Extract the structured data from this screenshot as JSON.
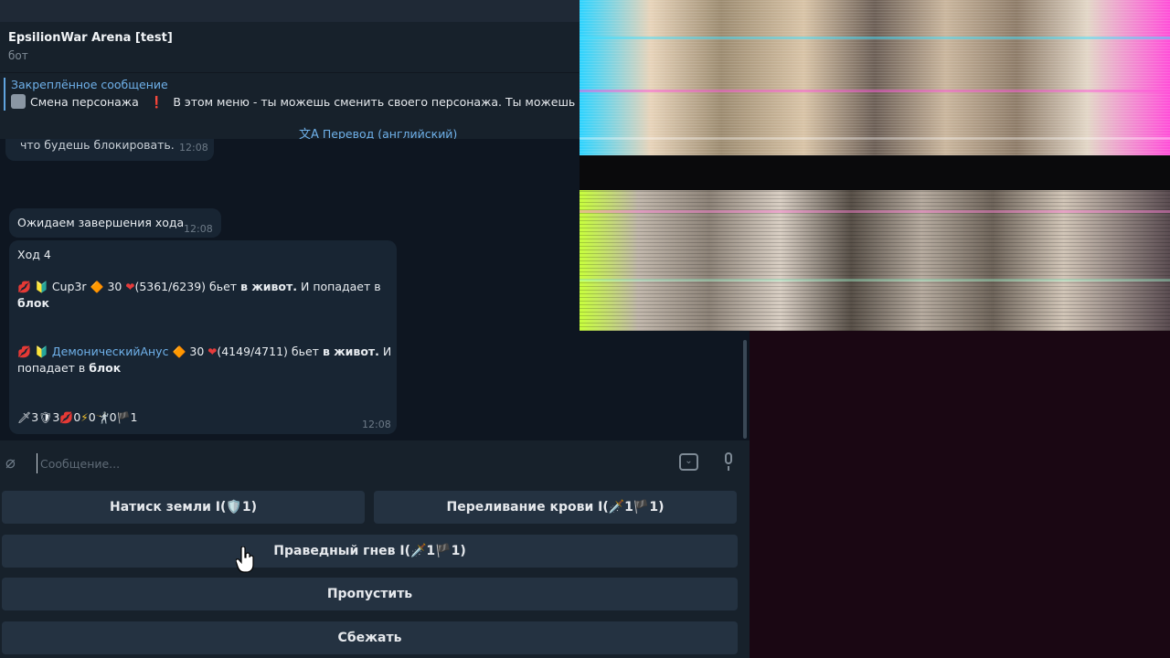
{
  "header": {
    "title": "EpsilionWar Arena [test]",
    "subtitle": "бот"
  },
  "pinned": {
    "title": "Закреплённое сообщение",
    "lead": "Смена персонажа",
    "text": "В этом меню - ты можешь сменить своего персонажа. Ты можешь иметь"
  },
  "translate": {
    "label": "Перевод (английский)"
  },
  "messages": [
    {
      "text": "что будешь блокировать.",
      "time": "12:08"
    },
    {
      "text": "Ожидаем завершения хода",
      "time": "12:08"
    },
    {
      "turn": "Ход 4",
      "line1_name": "Cup3r",
      "line1_level": "30",
      "line1_hp": "(5361/6239)",
      "line1_action": "бьет",
      "line1_target": "в живот.",
      "line1_result": "И попадает в",
      "line1_block": "блок",
      "line2_name": "ДемоническийАнус",
      "line2_level": "30",
      "line2_hp": "(4149/4711)",
      "line2_action": "бьет",
      "line2_target": "в живот.",
      "line2_result": "И",
      "line2_result2": "попадает в",
      "line2_block": "блок",
      "stats": "3  3  0  0  0  1",
      "time": "12:08"
    }
  ],
  "input": {
    "placeholder": "Сообщение..."
  },
  "keyboard": {
    "btn1": "Натиск земли I(🛡️1)",
    "btn2": "Переливание крови I(🗡️1🏴1)",
    "btn3": "Праведный гнев I(🗡️1🏴1)",
    "btn4": "Пропустить",
    "btn5": "Сбежать"
  },
  "colors": {
    "accent": "#6fb1ea",
    "chat_bg": "#0e1621",
    "bubble": "#182533",
    "button": "#243241"
  }
}
